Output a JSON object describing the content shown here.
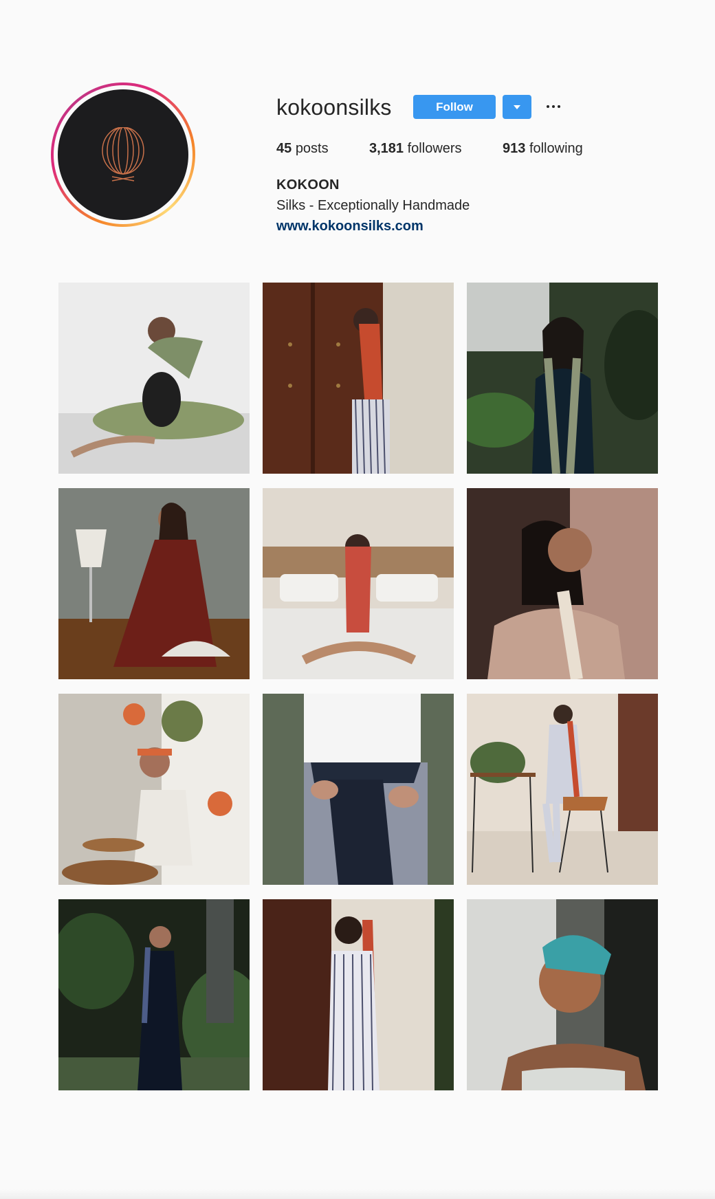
{
  "profile": {
    "username": "kokoonsilks",
    "avatar_icon": "kokoon-logo-icon",
    "follow_label": "Follow",
    "dropdown_icon": "caret-down-icon",
    "more_icon": "more-options-icon",
    "accent_color": "#3897f0",
    "link_color": "#003569",
    "stats": {
      "posts_count": "45",
      "posts_label": "posts",
      "followers_count": "3,181",
      "followers_label": "followers",
      "following_count": "913",
      "following_label": "following"
    },
    "full_name": "KOKOON",
    "bio": "Silks - Exceptionally Handmade",
    "website": "www.kokoonsilks.com"
  },
  "posts": [
    {
      "id": "post-1",
      "subject": "woman with green fan seated on floor"
    },
    {
      "id": "post-2",
      "subject": "woman with red scarf by wooden door"
    },
    {
      "id": "post-3",
      "subject": "woman with green scarf in garden"
    },
    {
      "id": "post-4",
      "subject": "woman in burgundy dress with fan"
    },
    {
      "id": "post-5",
      "subject": "woman with red scarf sitting on bed"
    },
    {
      "id": "post-6",
      "subject": "woman in profile with white scarf"
    },
    {
      "id": "post-7",
      "subject": "woman with headscarf and bowls"
    },
    {
      "id": "post-8",
      "subject": "navy silk tied at waist"
    },
    {
      "id": "post-9",
      "subject": "woman in striped jumpsuit on chair"
    },
    {
      "id": "post-10",
      "subject": "woman in navy dress in garden"
    },
    {
      "id": "post-11",
      "subject": "woman in striped jumpsuit with red scarf"
    },
    {
      "id": "post-12",
      "subject": "woman with teal headscarf in light"
    }
  ]
}
